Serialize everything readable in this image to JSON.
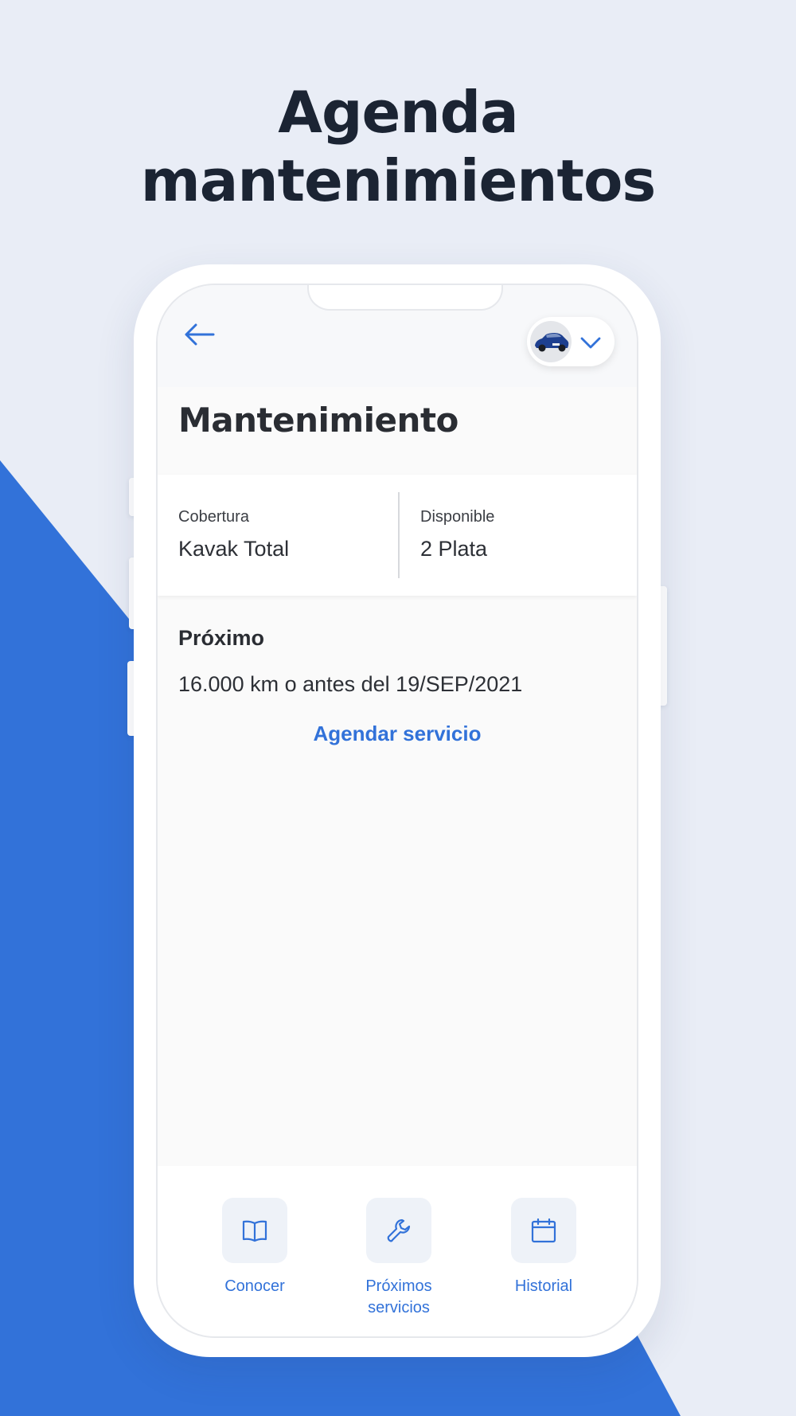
{
  "headline": {
    "line1": "Agenda",
    "line2": "mantenimientos"
  },
  "header": {
    "back_icon": "arrow-left-icon",
    "vehicle_selector_icon": "chevron-down-icon"
  },
  "page": {
    "title": "Mantenimiento"
  },
  "info": {
    "coverage_label": "Cobertura",
    "coverage_value": "Kavak Total",
    "available_label": "Disponible",
    "available_value": "2 Plata"
  },
  "next_service": {
    "title": "Próximo",
    "detail": "16.000 km o antes del 19/SEP/2021",
    "action_label": "Agendar servicio"
  },
  "bottom_nav": {
    "items": [
      {
        "label": "Conocer",
        "icon": "book-icon"
      },
      {
        "label": "Próximos servicios",
        "icon": "wrench-icon"
      },
      {
        "label": "Historial",
        "icon": "calendar-icon"
      }
    ]
  },
  "colors": {
    "accent": "#3272d9",
    "background": "#e9edf6",
    "headline": "#1b2433"
  }
}
